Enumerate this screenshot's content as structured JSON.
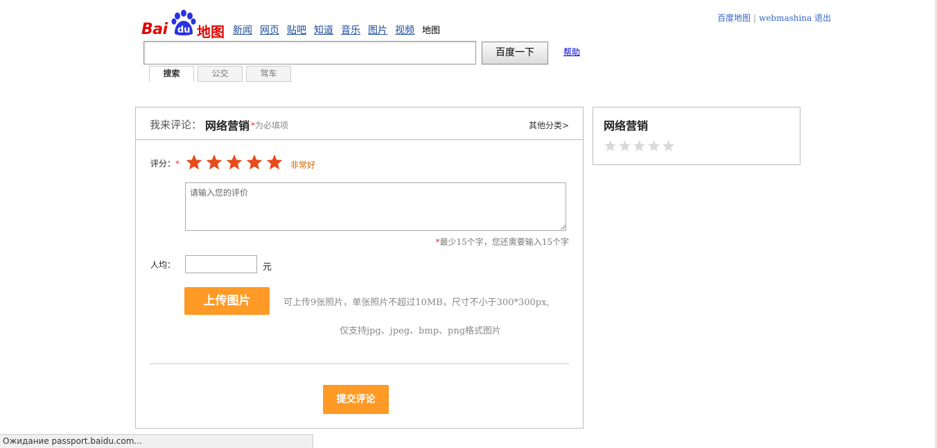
{
  "header": {
    "user_links": {
      "map_home": "百度地图",
      "username": "webmashina",
      "logout": "退出"
    },
    "logo": {
      "bai": "Bai",
      "du": "du",
      "ditu": "地图"
    },
    "nav": [
      "新闻",
      "网页",
      "贴吧",
      "知道",
      "音乐",
      "图片",
      "视频"
    ],
    "nav_current": "地图",
    "search": {
      "value": "",
      "button_label": "百度一下",
      "help_label": "帮助"
    },
    "mode_tabs": [
      "搜索",
      "公交",
      "驾车"
    ]
  },
  "review": {
    "header_label": "我来评论：",
    "place_name": "网络营销",
    "required_star": "*",
    "required_note": "为必填项",
    "other_categories": "其他分类>",
    "rating_label": "评分：",
    "rating_star": "*",
    "rating_value": 5,
    "rating_max": 5,
    "rating_text": "非常好",
    "star_color": "#e84b1b",
    "textarea_placeholder": "请输入您的评价",
    "hint_star": "*",
    "hint": "最少15个字，您还需要输入15个字",
    "price_label": "人均：",
    "price_value": "",
    "price_unit": "元",
    "upload_label": "上传图片",
    "upload_note_1": "可上传9张照片，单张照片不超过10MB，尺寸不小于300*300px,",
    "upload_note_2": "仅支持jpg、jpeg、bmp、png格式图片",
    "submit_label": "提交评论",
    "button_color": "#ff9a26"
  },
  "side": {
    "title": "网络营销",
    "rating_value": 0,
    "rating_max": 5
  },
  "statusbar": {
    "text": "Ожидание passport.baidu.com..."
  }
}
